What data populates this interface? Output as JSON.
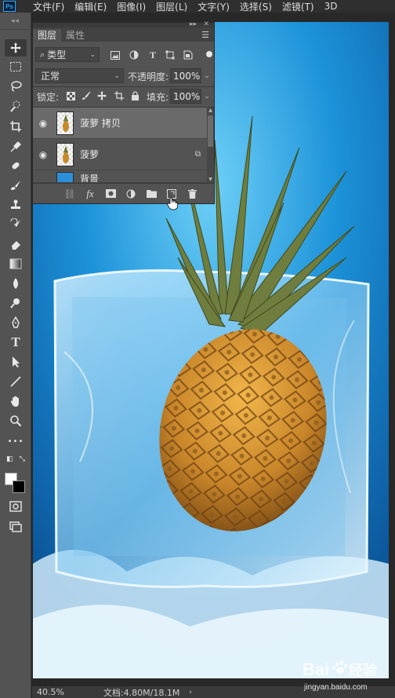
{
  "menubar": {
    "logo": "Ps",
    "items": [
      "文件(F)",
      "编辑(E)",
      "图像(I)",
      "图层(L)",
      "文字(Y)",
      "选择(S)",
      "滤镜(T)",
      "3D"
    ]
  },
  "toolbox": {
    "tools": [
      "move-tool-icon",
      "marquee-tool-icon",
      "lasso-tool-icon",
      "quick-select-tool-icon",
      "crop-tool-icon",
      "eyedropper-tool-icon",
      "healing-brush-tool-icon",
      "brush-tool-icon",
      "clone-stamp-tool-icon",
      "history-brush-tool-icon",
      "eraser-tool-icon",
      "gradient-tool-icon",
      "blur-tool-icon",
      "dodge-tool-icon",
      "pen-tool-icon",
      "type-tool-icon",
      "path-select-tool-icon",
      "line-tool-icon",
      "hand-tool-icon",
      "zoom-tool-icon",
      "more-tools-icon"
    ],
    "type_glyph": "T",
    "more_glyph": "•••"
  },
  "layers_panel": {
    "tabs": [
      "图层",
      "属性"
    ],
    "filter_label": "类型",
    "blend_mode": "正常",
    "opacity_label": "不透明度:",
    "opacity_value": "100%",
    "lock_label": "锁定:",
    "fill_label": "填充:",
    "fill_value": "100%",
    "layers": [
      {
        "name": "菠萝 拷贝",
        "visible": true,
        "selected": true
      },
      {
        "name": "菠萝",
        "visible": true,
        "selected": false
      },
      {
        "name": "背景",
        "visible": false,
        "selected": false
      }
    ],
    "bottom_icons": [
      "link-layers-icon",
      "fx-icon",
      "add-mask-icon",
      "adjustment-layer-icon",
      "new-group-icon",
      "new-layer-icon",
      "delete-layer-icon"
    ],
    "fx_label": "fx"
  },
  "statusbar": {
    "zoom": "40.5%",
    "doc_info": "文档:4.80M/18.1M"
  },
  "watermark": {
    "brand": "Baidu",
    "brand_cn": "经验",
    "url": "jingyan.baidu.com"
  }
}
